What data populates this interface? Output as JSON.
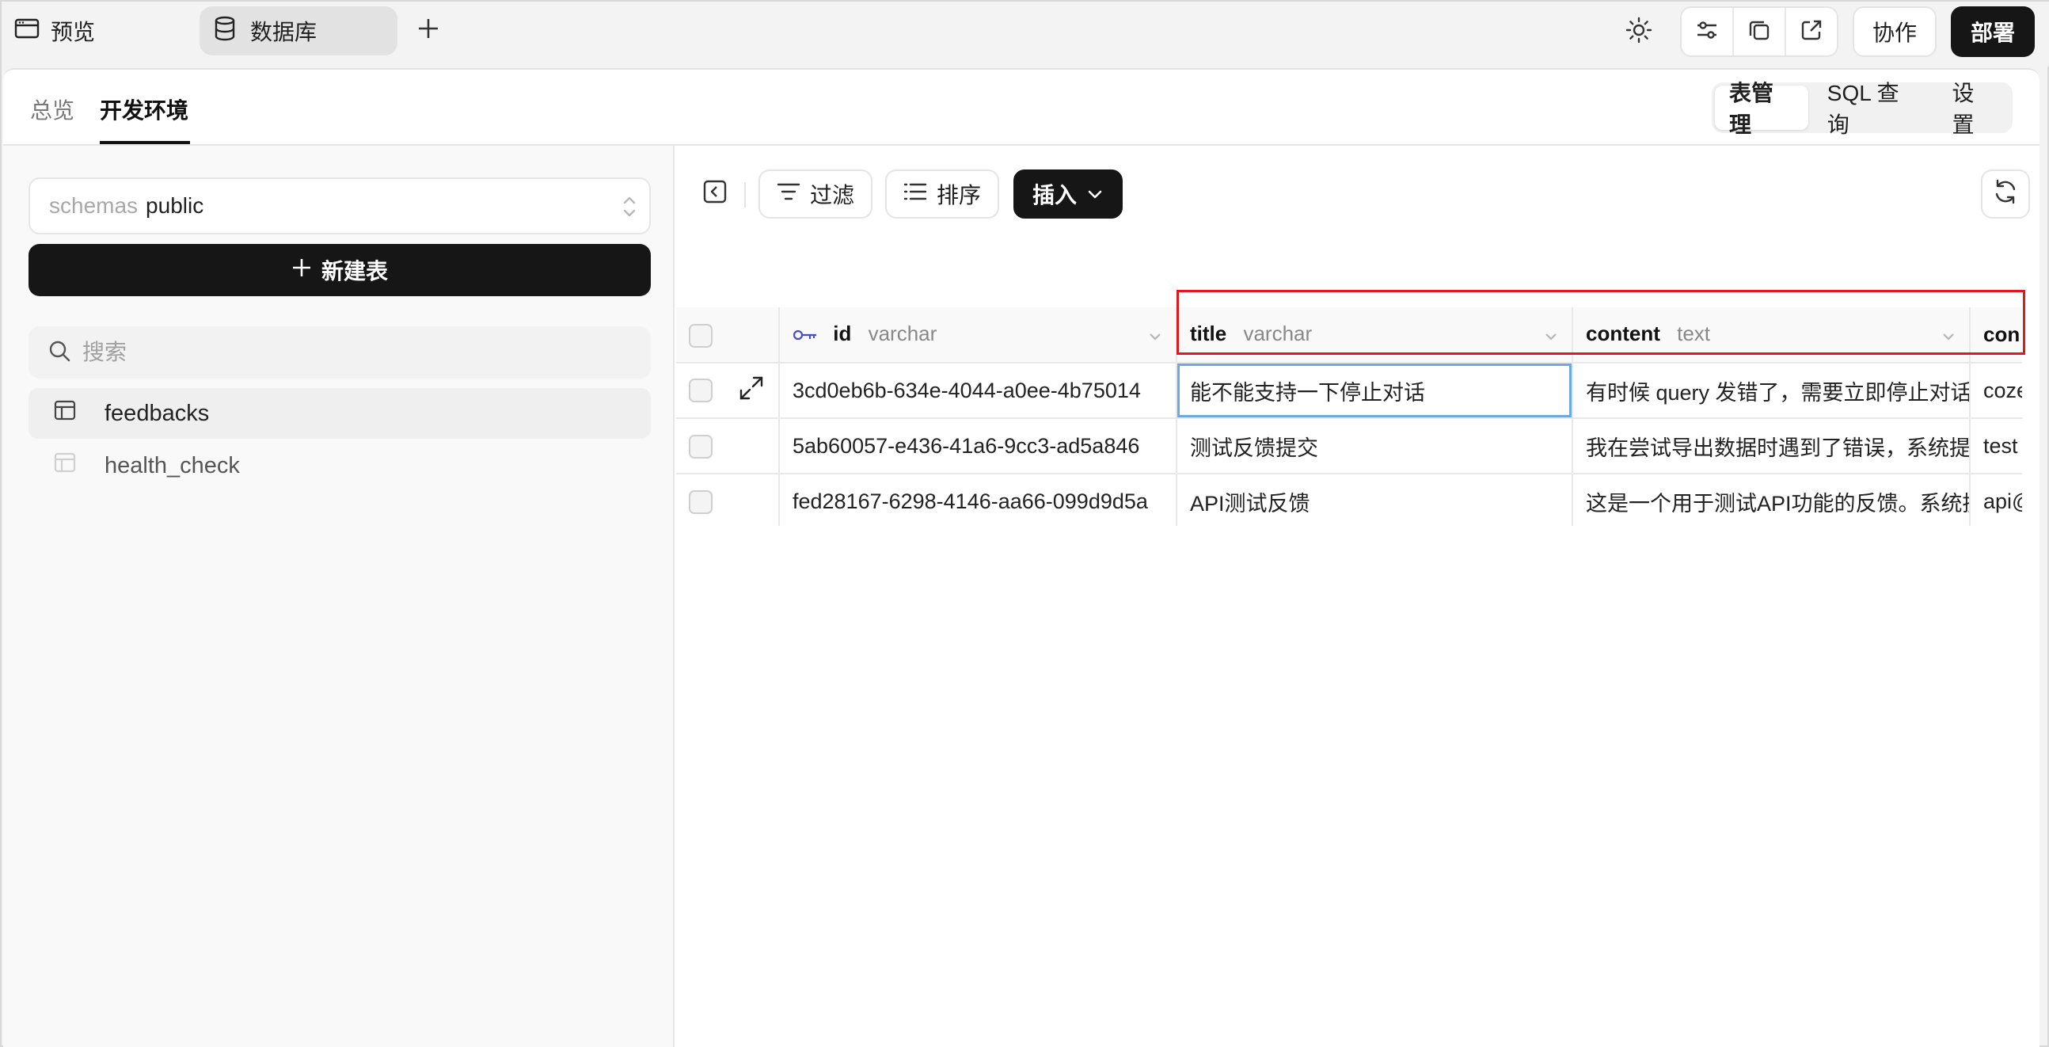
{
  "topbar": {
    "preview_label": "预览",
    "db_tab_label": "数据库",
    "collab_label": "协作",
    "deploy_label": "部署"
  },
  "tabs": {
    "overview": "总览",
    "dev_env": "开发环境",
    "right": [
      "表管理",
      "SQL 查询",
      "设置"
    ]
  },
  "sidebar": {
    "schema_label": "schemas",
    "schema_value": "public",
    "new_table": "新建表",
    "search_placeholder": "搜索",
    "tables": [
      "feedbacks",
      "health_check"
    ]
  },
  "toolbar": {
    "filter": "过滤",
    "sort": "排序",
    "insert": "插入"
  },
  "grid": {
    "columns": [
      {
        "name": "id",
        "type": "varchar"
      },
      {
        "name": "title",
        "type": "varchar"
      },
      {
        "name": "content",
        "type": "text"
      },
      {
        "name": "con",
        "type": ""
      }
    ],
    "rows": [
      [
        "3cd0eb6b-634e-4044-a0ee-4b75014",
        "能不能支持一下停止对话",
        "有时候 query 发错了，需要立即停止对话",
        "coze"
      ],
      [
        "5ab60057-e436-41a6-9cc3-ad5a846",
        "测试反馈提交",
        "我在尝试导出数据时遇到了错误，系统提示",
        "test"
      ],
      [
        "fed28167-6298-4146-aa66-099d9d5a",
        "API测试反馈",
        "这是一个用于测试API功能的反馈。系统提示",
        "api@"
      ]
    ]
  },
  "colors": {
    "accent_dark": "#161616",
    "selection": "#6ea8e0",
    "highlight_box": "#e0191d",
    "key_icon": "#4a4ad0"
  }
}
